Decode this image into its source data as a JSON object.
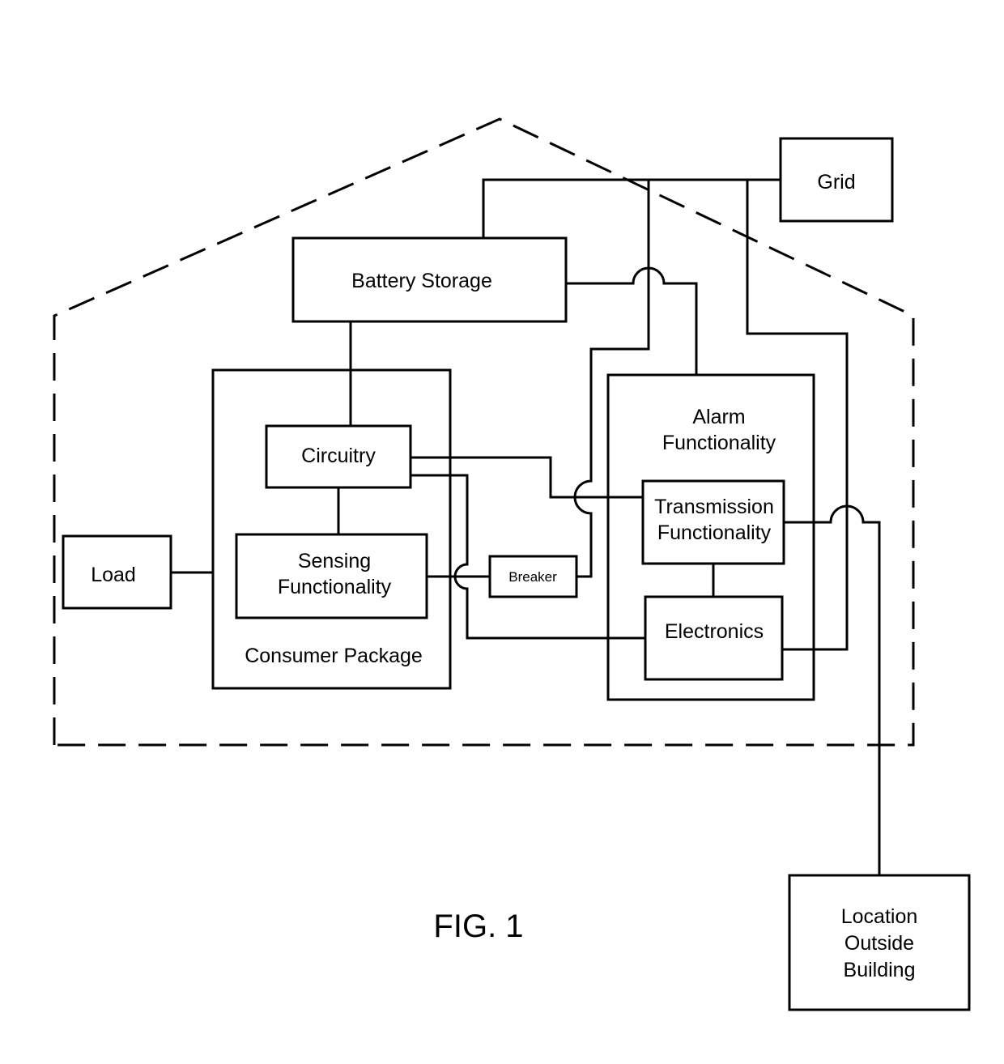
{
  "figure": {
    "caption": "FIG. 1",
    "boundary": "building"
  },
  "nodes": {
    "grid": {
      "label": "Grid"
    },
    "battery_storage": {
      "label": "Battery Storage"
    },
    "consumer_package": {
      "label": "Consumer Package"
    },
    "circuitry": {
      "label": "Circuitry"
    },
    "sensing": {
      "lines": [
        "Sensing",
        "Functionality"
      ]
    },
    "load": {
      "label": "Load"
    },
    "breaker": {
      "label": "Breaker"
    },
    "alarm": {
      "lines": [
        "Alarm",
        "Functionality"
      ]
    },
    "transmission": {
      "lines": [
        "Transmission",
        "Functionality"
      ]
    },
    "electronics": {
      "label": "Electronics"
    },
    "location_outside": {
      "lines": [
        "Location",
        "Outside",
        "Building"
      ]
    }
  },
  "connections": [
    {
      "from": "grid",
      "to": "battery_storage"
    },
    {
      "from": "grid",
      "to": "breaker"
    },
    {
      "from": "grid",
      "to": "electronics"
    },
    {
      "from": "battery_storage",
      "to": "circuitry"
    },
    {
      "from": "battery_storage",
      "to": "alarm"
    },
    {
      "from": "circuitry",
      "to": "sensing"
    },
    {
      "from": "circuitry",
      "to": "transmission"
    },
    {
      "from": "circuitry",
      "to": "electronics"
    },
    {
      "from": "sensing",
      "to": "breaker"
    },
    {
      "from": "load",
      "to": "consumer_package"
    },
    {
      "from": "transmission",
      "to": "electronics"
    },
    {
      "from": "transmission",
      "to": "location_outside"
    }
  ]
}
